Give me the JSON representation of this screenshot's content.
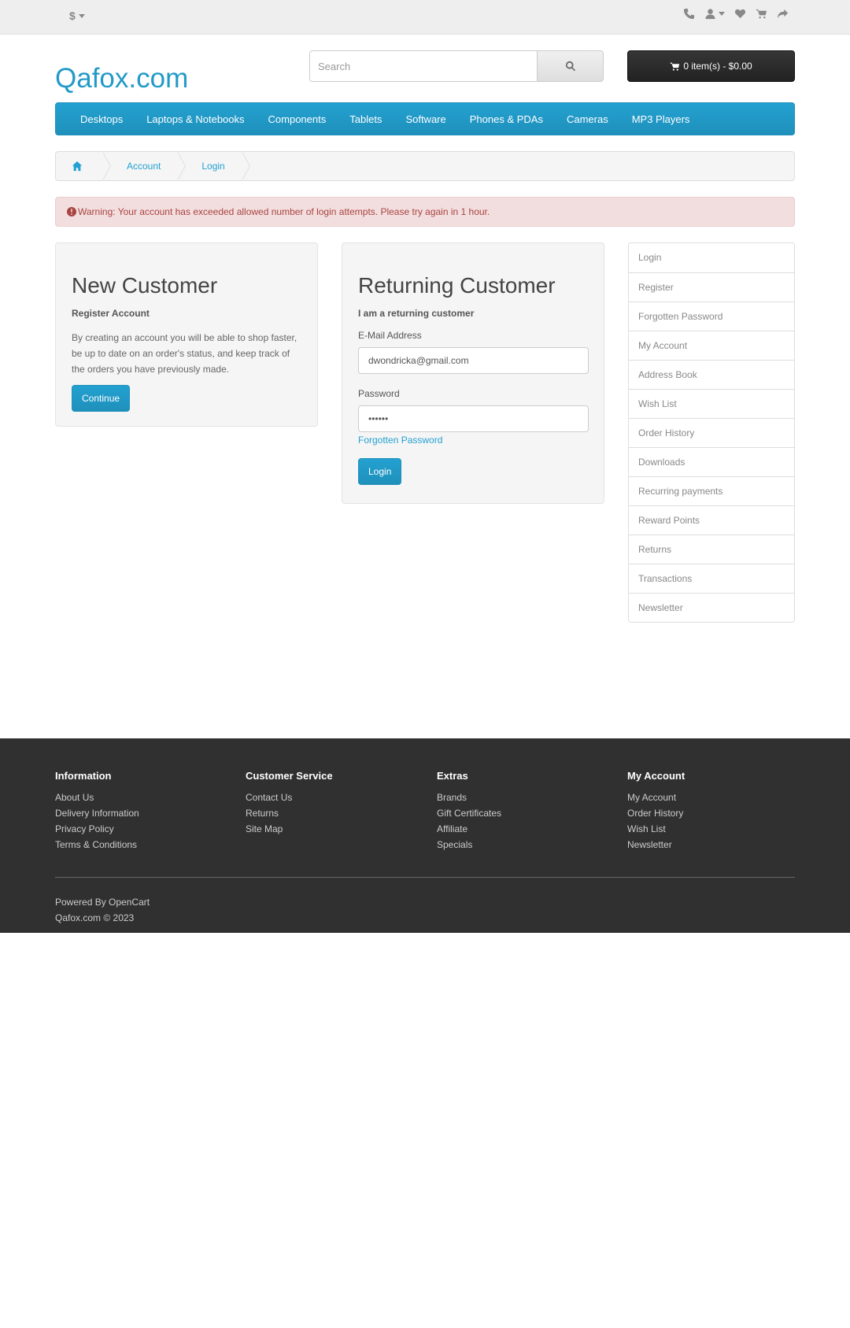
{
  "topbar": {
    "currency": "$",
    "icons": [
      "phone-icon",
      "user-icon",
      "heart-icon",
      "cart-icon",
      "share-icon"
    ]
  },
  "header": {
    "logo": "Qafox.com",
    "search_placeholder": "Search",
    "cart_label": "0 item(s) - $0.00"
  },
  "menu": [
    "Desktops",
    "Laptops & Notebooks",
    "Components",
    "Tablets",
    "Software",
    "Phones & PDAs",
    "Cameras",
    "MP3 Players"
  ],
  "breadcrumb": [
    "Account",
    "Login"
  ],
  "alert": "Warning: Your account has exceeded allowed number of login attempts. Please try again in 1 hour.",
  "new_customer": {
    "title": "New Customer",
    "subtitle": "Register Account",
    "text": "By creating an account you will be able to shop faster, be up to date on an order's status, and keep track of the orders you have previously made.",
    "button": "Continue"
  },
  "returning_customer": {
    "title": "Returning Customer",
    "subtitle": "I am a returning customer",
    "email_label": "E-Mail Address",
    "email_value": "dwondricka@gmail.com",
    "password_label": "Password",
    "password_value": "••••••",
    "forgot_link": "Forgotten Password",
    "button": "Login"
  },
  "sidebar": [
    "Login",
    "Register",
    "Forgotten Password",
    "My Account",
    "Address Book",
    "Wish List",
    "Order History",
    "Downloads",
    "Recurring payments",
    "Reward Points",
    "Returns",
    "Transactions",
    "Newsletter"
  ],
  "footer": {
    "columns": [
      {
        "title": "Information",
        "links": [
          "About Us",
          "Delivery Information",
          "Privacy Policy",
          "Terms & Conditions"
        ]
      },
      {
        "title": "Customer Service",
        "links": [
          "Contact Us",
          "Returns",
          "Site Map"
        ]
      },
      {
        "title": "Extras",
        "links": [
          "Brands",
          "Gift Certificates",
          "Affiliate",
          "Specials"
        ]
      },
      {
        "title": "My Account",
        "links": [
          "My Account",
          "Order History",
          "Wish List",
          "Newsletter"
        ]
      }
    ],
    "powered_prefix": "Powered By",
    "powered_link": "OpenCart",
    "copyright": "Qafox.com © 2023"
  },
  "colors": {
    "accent": "#229ac8",
    "alert_bg": "#f2dede",
    "alert_text": "#a94442",
    "footer_bg": "#303030"
  }
}
